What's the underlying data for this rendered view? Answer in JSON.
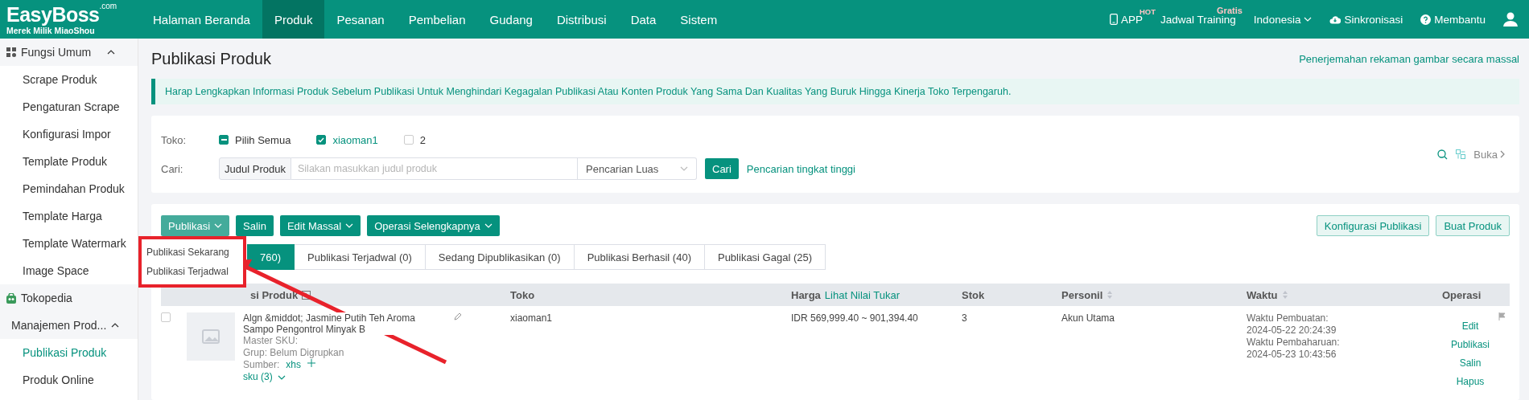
{
  "topbar": {
    "logo": {
      "name": "EasyBoss",
      "suffix": ".com",
      "tagline": "Merek Milik MiaoShou"
    },
    "nav": [
      {
        "label": "Halaman Beranda",
        "selected": false
      },
      {
        "label": "Produk",
        "selected": true
      },
      {
        "label": "Pesanan",
        "selected": false
      },
      {
        "label": "Pembelian",
        "selected": false
      },
      {
        "label": "Gudang",
        "selected": false
      },
      {
        "label": "Distribusi",
        "selected": false
      },
      {
        "label": "Data",
        "selected": false
      },
      {
        "label": "Sistem",
        "selected": false
      }
    ],
    "app": {
      "label": "APP",
      "badge": "HOT"
    },
    "training": {
      "label": "Jadwal Training",
      "badge": "Gratis"
    },
    "language": "Indonesia",
    "sync": "Sinkronisasi",
    "help": "Membantu"
  },
  "sidebar": {
    "groups": [
      {
        "label": "Fungsi Umum",
        "expanded": true,
        "children": [
          {
            "label": "Scrape Produk",
            "selected": false
          },
          {
            "label": "Pengaturan Scrape",
            "selected": false
          },
          {
            "label": "Konfigurasi Impor",
            "selected": false
          },
          {
            "label": "Template Produk",
            "selected": false
          },
          {
            "label": "Pemindahan Produk",
            "selected": false
          },
          {
            "label": "Template Harga",
            "selected": false
          },
          {
            "label": "Template Watermark",
            "selected": false
          },
          {
            "label": "Image Space",
            "selected": false
          }
        ]
      },
      {
        "label": "Tokopedia"
      },
      {
        "label": "Manajemen Prod...",
        "expanded": true,
        "children": [
          {
            "label": "Publikasi Produk",
            "selected": true
          },
          {
            "label": "Produk Online",
            "selected": false
          }
        ]
      }
    ]
  },
  "page": {
    "title": "Publikasi Produk",
    "header_link": "Penerjemahan rekaman gambar secara massal",
    "notice": "Harap Lengkapkan Informasi Produk Sebelum Publikasi Untuk Menghindari Kegagalan Publikasi Atau Konten Produk Yang Sama Dan Kualitas Yang Buruk Hingga Kinerja Toko Terpengaruh."
  },
  "filter": {
    "store_label": "Toko:",
    "stores": [
      {
        "label": "Pilih Semua",
        "checked": false,
        "indeterminate": true
      },
      {
        "label": "xiaoman1",
        "checked": true,
        "indeterminate": false
      },
      {
        "label": "2",
        "checked": false,
        "indeterminate": false
      }
    ],
    "search_label": "Cari:",
    "search_field": "Judul Produk",
    "placeholder": "Silakan masukkan judul produk",
    "search_mode": "Pencarian Luas",
    "search_button": "Cari",
    "advanced_link": "Pencarian tingkat tinggi",
    "expand": "Buka"
  },
  "toolbar": {
    "left": [
      {
        "label": "Publikasi",
        "dropdown": true,
        "expanded": true
      },
      {
        "label": "Salin",
        "dropdown": false,
        "expanded": false
      },
      {
        "label": "Edit Massal",
        "dropdown": true,
        "expanded": false
      },
      {
        "label": "Operasi Selengkapnya",
        "dropdown": true,
        "expanded": false
      }
    ],
    "right": [
      "Konfigurasi Publikasi",
      "Buat Produk"
    ]
  },
  "dropdown_menu": [
    "Publikasi Sekarang",
    "Publikasi Terjadwal"
  ],
  "tabs": [
    {
      "label": "760)",
      "selected": true
    },
    {
      "label": "Publikasi Terjadwal (0)",
      "selected": false
    },
    {
      "label": "Sedang Dipublikasikan (0)",
      "selected": false
    },
    {
      "label": "Publikasi Berhasil (40)",
      "selected": false
    },
    {
      "label": "Publikasi Gagal (25)",
      "selected": false
    }
  ],
  "table": {
    "columns": [
      {
        "label": "si Produk",
        "kind": "expand"
      },
      {
        "label": "Toko",
        "kind": "plain"
      },
      {
        "label": "Harga",
        "kind": "link",
        "link": "Lihat Nilai Tukar"
      },
      {
        "label": "Stok",
        "kind": "plain"
      },
      {
        "label": "Personil",
        "kind": "sort"
      },
      {
        "label": "Waktu",
        "kind": "sort"
      },
      {
        "label": "Operasi",
        "kind": "plain"
      }
    ],
    "rows": [
      {
        "checked": false,
        "title": "Algn &middot; Jasmine Putih Teh Aroma Sampo Pengontrol Minyak B",
        "master_sku": "Master SKU:",
        "group_label": "Grup:",
        "group": "Belum Digrupkan",
        "source_label": "Sumber:",
        "source": "xhs",
        "sku": "sku (3)",
        "store": "xiaoman1",
        "price": "IDR 569,999.40 ~ 901,394.40",
        "stock": "3",
        "personnel": "Akun Utama",
        "times": [
          "Waktu Pembuatan:",
          "2024-05-22 20:24:39",
          "Waktu Pembaharuan:",
          "2024-05-23 10:43:56"
        ],
        "actions": [
          "Edit",
          "Publikasi",
          "Salin",
          "Hapus"
        ]
      }
    ]
  }
}
